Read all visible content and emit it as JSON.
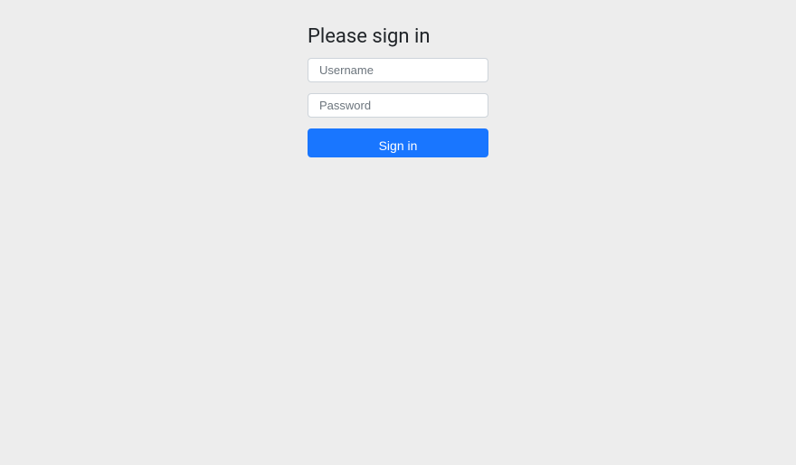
{
  "login": {
    "heading": "Please sign in",
    "username_placeholder": "Username",
    "password_placeholder": "Password",
    "submit_label": "Sign in"
  }
}
